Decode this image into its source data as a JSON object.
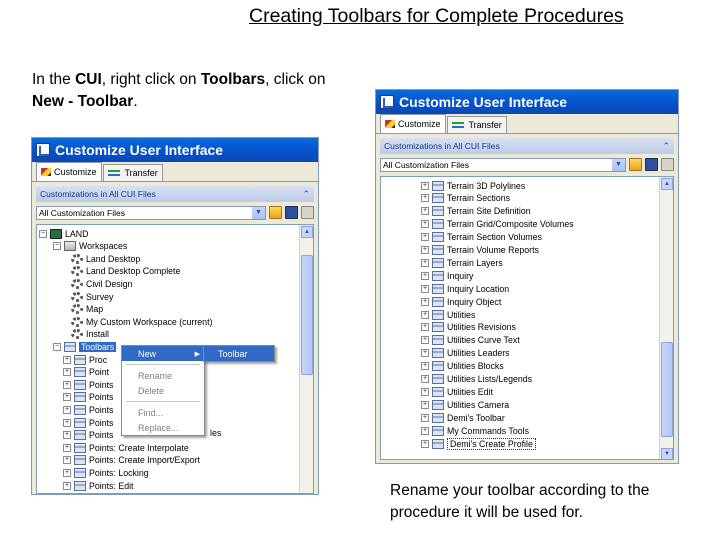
{
  "slide": {
    "title": "Creating Toolbars for Complete Procedures",
    "instruction_left": {
      "p1": "In the ",
      "b1": "CUI",
      "p2": ", right click on ",
      "b2": "Toolbars",
      "p3": ", click on ",
      "b3": "New - Toolbar",
      "p4": "."
    },
    "instruction_right": "Rename your toolbar according to the procedure it will be used for."
  },
  "window_left": {
    "title": "Customize User Interface",
    "tabs": [
      "Customize",
      "Transfer"
    ],
    "panel_header": "Customizations in All CUI Files",
    "combo_value": "All Customization Files",
    "tree": [
      {
        "label": "LAND",
        "expander": "−",
        "icon": "land-icon"
      },
      {
        "label": "Workspaces",
        "expander": "−",
        "icon": "ws-icon"
      },
      {
        "label": "Land Desktop",
        "icon": "gear-icon"
      },
      {
        "label": "Land Desktop Complete",
        "icon": "gear-icon"
      },
      {
        "label": "Civil Design",
        "icon": "gear-icon"
      },
      {
        "label": "Survey",
        "icon": "gear-icon"
      },
      {
        "label": "Map",
        "icon": "gear-icon"
      },
      {
        "label": "My Custom Workspace (current)",
        "icon": "gear-icon"
      },
      {
        "label": "Install",
        "icon": "gear-icon"
      },
      {
        "label": "Toolbars",
        "expander": "−",
        "icon": "toolbar-icon",
        "selected": true
      },
      {
        "label": "Proc",
        "expander": "+",
        "icon": "toolbar-icon"
      },
      {
        "label": "Point",
        "expander": "+",
        "icon": "toolbar-icon"
      },
      {
        "label": "Points",
        "expander": "+",
        "icon": "toolbar-icon"
      },
      {
        "label": "Points",
        "expander": "+",
        "icon": "toolbar-icon"
      },
      {
        "label": "Points",
        "expander": "+",
        "icon": "toolbar-icon"
      },
      {
        "label": "Points",
        "expander": "+",
        "icon": "toolbar-icon"
      },
      {
        "label": "Points",
        "expander": "+",
        "icon": "toolbar-icon"
      },
      {
        "label": "Points: Create Interpolate",
        "expander": "+",
        "icon": "toolbar-icon"
      },
      {
        "label": "Points: Create Import/Export",
        "expander": "+",
        "icon": "toolbar-icon"
      },
      {
        "label": "Points: Locking",
        "expander": "+",
        "icon": "toolbar-icon"
      },
      {
        "label": "Points: Edit",
        "expander": "+",
        "icon": "toolbar-icon"
      }
    ],
    "hidden_tail": "les",
    "context_menu": [
      "New",
      "Rename",
      "Delete",
      "Find...",
      "Replace..."
    ],
    "submenu": [
      "Toolbar"
    ]
  },
  "window_right": {
    "title": "Customize User Interface",
    "tabs": [
      "Customize",
      "Transfer"
    ],
    "panel_header": "Customizations in All CUI Files",
    "combo_value": "All Customization Files",
    "tree": [
      "Terrain 3D Polylines",
      "Terrain Sections",
      "Terrain Site Definition",
      "Terrain Grid/Composite Volumes",
      "Terrain Section Volumes",
      "Terrain Volume Reports",
      "Terrain Layers",
      "Inquiry",
      "Inquiry Location",
      "Inquiry Object",
      "Utilities",
      "Utilities Revisions",
      "Utilities Curve Text",
      "Utilities Leaders",
      "Utilities Blocks",
      "Utilities Lists/Legends",
      "Utilities Edit",
      "Utilities Camera",
      "Demi's Toolbar",
      "My Commands Tools",
      "Demi's Create Profile"
    ]
  }
}
